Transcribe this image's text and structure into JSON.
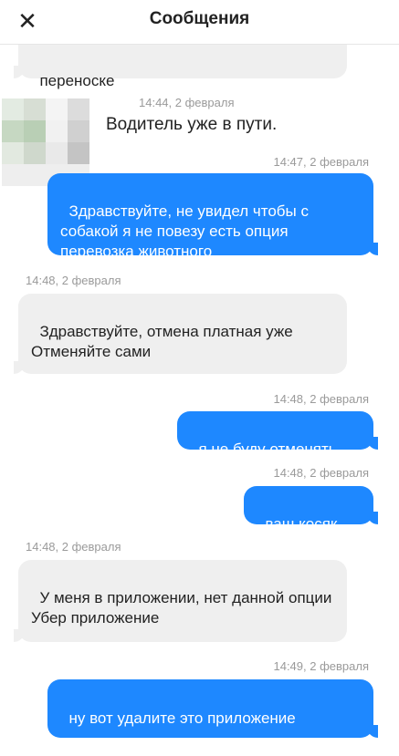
{
  "header": {
    "close_icon": "close-icon",
    "title": "Сообщения"
  },
  "messages": [
    {
      "side": "in",
      "text": "переноске"
    },
    {
      "side": "in",
      "time": "14:44, 2 февраля",
      "text": "Водитель уже в пути."
    },
    {
      "side": "out",
      "time": "14:47, 2 февраля",
      "text": "Здравствуйте, не увидел чтобы с собакой я не повезу есть опция перевозка животного"
    },
    {
      "side": "in",
      "time": "14:48, 2 февраля",
      "text": "Здравствуйте, отмена платная уже\nОтменяйте сами"
    },
    {
      "side": "out",
      "time": "14:48, 2 февраля",
      "text": "я не буду отменять"
    },
    {
      "side": "out",
      "time": "14:48, 2 февраля",
      "text": "ваш косяк"
    },
    {
      "side": "in",
      "time": "14:48, 2 февраля",
      "text": "У меня в приложении, нет данной опции\nУбер приложение"
    },
    {
      "side": "out",
      "time": "14:49, 2 февраля",
      "text": "ну вот удалите это приложение"
    }
  ],
  "colors": {
    "outgoing": "#1e88ff",
    "incoming": "#efefef",
    "timestamp": "#9a9a9a"
  }
}
